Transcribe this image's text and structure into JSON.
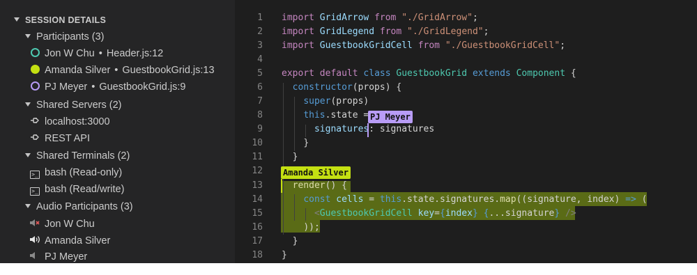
{
  "sidebar": {
    "title": "SESSION DETAILS",
    "participants": {
      "label": "Participants (3)",
      "items": [
        {
          "name": "Jon W Chu",
          "file": "Header.js:12",
          "color": "#4ec9b0"
        },
        {
          "name": "Amanda Silver",
          "file": "GuestbookGrid.js:13",
          "color": "#c4e012"
        },
        {
          "name": "PJ Meyer",
          "file": "GuestbookGrid.js:9",
          "color": "#b89cf6"
        }
      ]
    },
    "servers": {
      "label": "Shared Servers (2)",
      "items": [
        "localhost:3000",
        "REST API"
      ]
    },
    "terminals": {
      "label": "Shared Terminals (2)",
      "items": [
        "bash (Read-only)",
        "bash (Read/write)"
      ]
    },
    "audio": {
      "label": "Audio Participants (3)",
      "items": [
        {
          "name": "Jon W Chu",
          "state": "muted"
        },
        {
          "name": "Amanda Silver",
          "state": "speaking"
        },
        {
          "name": "PJ Meyer",
          "state": "listening"
        }
      ]
    },
    "separator": "•"
  },
  "editor": {
    "line_numbers": [
      "1",
      "2",
      "3",
      "4",
      "5",
      "6",
      "7",
      "8",
      "9",
      "10",
      "11",
      "12",
      "13",
      "14",
      "15",
      "16",
      "17",
      "18"
    ],
    "code": {
      "l1": {
        "kw": "import",
        "name": "GridArrow",
        "from": "from",
        "path": "\"./GridArrow\"",
        "end": ";"
      },
      "l2": {
        "kw": "import",
        "name": "GridLegend",
        "from": "from",
        "path": "\"./GridLegend\"",
        "end": ";"
      },
      "l3": {
        "kw": "import",
        "name": "GuestbookGridCell",
        "from": "from",
        "path": "\"./GuestbookGridCell\"",
        "end": ";"
      },
      "l5": {
        "export": "export",
        "default": "default",
        "class": "class",
        "name": "GuestbookGrid",
        "extends": "extends",
        "parent": "Component",
        "brace": "{"
      },
      "l6": {
        "fn": "constructor",
        "args": "(props) {"
      },
      "l7": {
        "kw": "super",
        "args": "(props)"
      },
      "l8": {
        "this": "this",
        "rest": ".state ="
      },
      "l9": {
        "prop": "signatures",
        "rest": ": signatures"
      },
      "l10": "}",
      "l11": "}",
      "l13": {
        "fn": "render",
        "rest": "() {"
      },
      "l14": {
        "const": "const",
        "var": "cells",
        "eq": " = ",
        "this": "this",
        "chain": ".state.signatures.",
        "map": "map",
        "args": "((signature, index) ",
        "arrow": "=>",
        "paren": " ("
      },
      "l15": {
        "open": "<",
        "tag": "GuestbookGridCell",
        "attr": " key",
        "eq": "=",
        "b1": "{",
        "v1": "index",
        "b2": "}",
        "sp": " ",
        "b3": "{",
        "spread": "...signature",
        "b4": "}",
        "close": " />"
      },
      "l16": "));",
      "l17": "}",
      "l18": "}"
    },
    "flags": {
      "amanda": "Amanda Silver",
      "pj": "PJ Meyer"
    },
    "colors": {
      "amanda": "#c4e012",
      "pj": "#b89cf6"
    }
  }
}
